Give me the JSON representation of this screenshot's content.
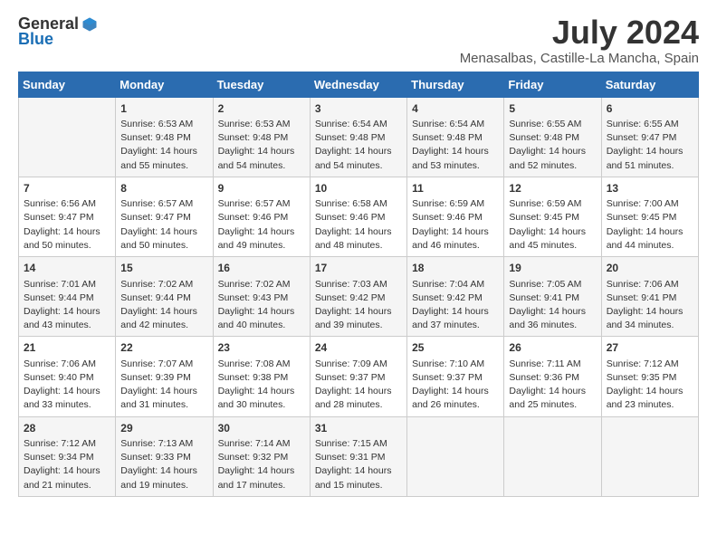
{
  "header": {
    "logo_general": "General",
    "logo_blue": "Blue",
    "main_title": "July 2024",
    "subtitle": "Menasalbas, Castille-La Mancha, Spain"
  },
  "days_of_week": [
    "Sunday",
    "Monday",
    "Tuesday",
    "Wednesday",
    "Thursday",
    "Friday",
    "Saturday"
  ],
  "weeks": [
    [
      {
        "day": "",
        "lines": []
      },
      {
        "day": "1",
        "lines": [
          "Sunrise: 6:53 AM",
          "Sunset: 9:48 PM",
          "Daylight: 14 hours",
          "and 55 minutes."
        ]
      },
      {
        "day": "2",
        "lines": [
          "Sunrise: 6:53 AM",
          "Sunset: 9:48 PM",
          "Daylight: 14 hours",
          "and 54 minutes."
        ]
      },
      {
        "day": "3",
        "lines": [
          "Sunrise: 6:54 AM",
          "Sunset: 9:48 PM",
          "Daylight: 14 hours",
          "and 54 minutes."
        ]
      },
      {
        "day": "4",
        "lines": [
          "Sunrise: 6:54 AM",
          "Sunset: 9:48 PM",
          "Daylight: 14 hours",
          "and 53 minutes."
        ]
      },
      {
        "day": "5",
        "lines": [
          "Sunrise: 6:55 AM",
          "Sunset: 9:48 PM",
          "Daylight: 14 hours",
          "and 52 minutes."
        ]
      },
      {
        "day": "6",
        "lines": [
          "Sunrise: 6:55 AM",
          "Sunset: 9:47 PM",
          "Daylight: 14 hours",
          "and 51 minutes."
        ]
      }
    ],
    [
      {
        "day": "7",
        "lines": [
          "Sunrise: 6:56 AM",
          "Sunset: 9:47 PM",
          "Daylight: 14 hours",
          "and 50 minutes."
        ]
      },
      {
        "day": "8",
        "lines": [
          "Sunrise: 6:57 AM",
          "Sunset: 9:47 PM",
          "Daylight: 14 hours",
          "and 50 minutes."
        ]
      },
      {
        "day": "9",
        "lines": [
          "Sunrise: 6:57 AM",
          "Sunset: 9:46 PM",
          "Daylight: 14 hours",
          "and 49 minutes."
        ]
      },
      {
        "day": "10",
        "lines": [
          "Sunrise: 6:58 AM",
          "Sunset: 9:46 PM",
          "Daylight: 14 hours",
          "and 48 minutes."
        ]
      },
      {
        "day": "11",
        "lines": [
          "Sunrise: 6:59 AM",
          "Sunset: 9:46 PM",
          "Daylight: 14 hours",
          "and 46 minutes."
        ]
      },
      {
        "day": "12",
        "lines": [
          "Sunrise: 6:59 AM",
          "Sunset: 9:45 PM",
          "Daylight: 14 hours",
          "and 45 minutes."
        ]
      },
      {
        "day": "13",
        "lines": [
          "Sunrise: 7:00 AM",
          "Sunset: 9:45 PM",
          "Daylight: 14 hours",
          "and 44 minutes."
        ]
      }
    ],
    [
      {
        "day": "14",
        "lines": [
          "Sunrise: 7:01 AM",
          "Sunset: 9:44 PM",
          "Daylight: 14 hours",
          "and 43 minutes."
        ]
      },
      {
        "day": "15",
        "lines": [
          "Sunrise: 7:02 AM",
          "Sunset: 9:44 PM",
          "Daylight: 14 hours",
          "and 42 minutes."
        ]
      },
      {
        "day": "16",
        "lines": [
          "Sunrise: 7:02 AM",
          "Sunset: 9:43 PM",
          "Daylight: 14 hours",
          "and 40 minutes."
        ]
      },
      {
        "day": "17",
        "lines": [
          "Sunrise: 7:03 AM",
          "Sunset: 9:42 PM",
          "Daylight: 14 hours",
          "and 39 minutes."
        ]
      },
      {
        "day": "18",
        "lines": [
          "Sunrise: 7:04 AM",
          "Sunset: 9:42 PM",
          "Daylight: 14 hours",
          "and 37 minutes."
        ]
      },
      {
        "day": "19",
        "lines": [
          "Sunrise: 7:05 AM",
          "Sunset: 9:41 PM",
          "Daylight: 14 hours",
          "and 36 minutes."
        ]
      },
      {
        "day": "20",
        "lines": [
          "Sunrise: 7:06 AM",
          "Sunset: 9:41 PM",
          "Daylight: 14 hours",
          "and 34 minutes."
        ]
      }
    ],
    [
      {
        "day": "21",
        "lines": [
          "Sunrise: 7:06 AM",
          "Sunset: 9:40 PM",
          "Daylight: 14 hours",
          "and 33 minutes."
        ]
      },
      {
        "day": "22",
        "lines": [
          "Sunrise: 7:07 AM",
          "Sunset: 9:39 PM",
          "Daylight: 14 hours",
          "and 31 minutes."
        ]
      },
      {
        "day": "23",
        "lines": [
          "Sunrise: 7:08 AM",
          "Sunset: 9:38 PM",
          "Daylight: 14 hours",
          "and 30 minutes."
        ]
      },
      {
        "day": "24",
        "lines": [
          "Sunrise: 7:09 AM",
          "Sunset: 9:37 PM",
          "Daylight: 14 hours",
          "and 28 minutes."
        ]
      },
      {
        "day": "25",
        "lines": [
          "Sunrise: 7:10 AM",
          "Sunset: 9:37 PM",
          "Daylight: 14 hours",
          "and 26 minutes."
        ]
      },
      {
        "day": "26",
        "lines": [
          "Sunrise: 7:11 AM",
          "Sunset: 9:36 PM",
          "Daylight: 14 hours",
          "and 25 minutes."
        ]
      },
      {
        "day": "27",
        "lines": [
          "Sunrise: 7:12 AM",
          "Sunset: 9:35 PM",
          "Daylight: 14 hours",
          "and 23 minutes."
        ]
      }
    ],
    [
      {
        "day": "28",
        "lines": [
          "Sunrise: 7:12 AM",
          "Sunset: 9:34 PM",
          "Daylight: 14 hours",
          "and 21 minutes."
        ]
      },
      {
        "day": "29",
        "lines": [
          "Sunrise: 7:13 AM",
          "Sunset: 9:33 PM",
          "Daylight: 14 hours",
          "and 19 minutes."
        ]
      },
      {
        "day": "30",
        "lines": [
          "Sunrise: 7:14 AM",
          "Sunset: 9:32 PM",
          "Daylight: 14 hours",
          "and 17 minutes."
        ]
      },
      {
        "day": "31",
        "lines": [
          "Sunrise: 7:15 AM",
          "Sunset: 9:31 PM",
          "Daylight: 14 hours",
          "and 15 minutes."
        ]
      },
      {
        "day": "",
        "lines": []
      },
      {
        "day": "",
        "lines": []
      },
      {
        "day": "",
        "lines": []
      }
    ]
  ]
}
